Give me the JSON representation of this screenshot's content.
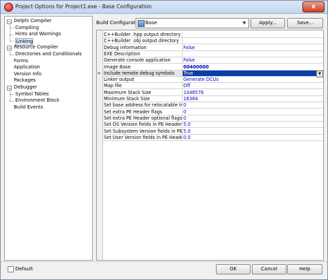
{
  "window": {
    "title": "Project Options for Project1.exe - Base Configuration",
    "close_glyph": "x"
  },
  "tree": {
    "items": [
      {
        "label": "Delphi Compiler",
        "level": 0,
        "expander": "−"
      },
      {
        "label": "Compiling",
        "level": 1
      },
      {
        "label": "Hints and Warnings",
        "level": 1
      },
      {
        "label": "Linking",
        "level": 1,
        "selected": true
      },
      {
        "label": "Resource Compiler",
        "level": 0,
        "expander": "−"
      },
      {
        "label": "Directories and Conditionals",
        "level": 1
      },
      {
        "label": "Forms",
        "level": 0
      },
      {
        "label": "Application",
        "level": 0
      },
      {
        "label": "Version Info",
        "level": 0
      },
      {
        "label": "Packages",
        "level": 0
      },
      {
        "label": "Debugger",
        "level": 0,
        "expander": "−"
      },
      {
        "label": "Symbol Tables",
        "level": 1
      },
      {
        "label": "Environment Block",
        "level": 1
      },
      {
        "label": "Build Events",
        "level": 0
      }
    ]
  },
  "build_config": {
    "label": "Build Configuration",
    "value": "Base",
    "apply_label": "Apply...",
    "save_label": "Save..."
  },
  "options": [
    {
      "name": "C++Builder .hpp output directory",
      "value": ""
    },
    {
      "name": "C++Builder .obj output directory",
      "value": ""
    },
    {
      "name": "Debug information",
      "value": "False"
    },
    {
      "name": "EXE Description",
      "value": ""
    },
    {
      "name": "Generate console application",
      "value": "False"
    },
    {
      "name": "Image Base",
      "value": "00400000",
      "bold": true
    },
    {
      "name": "Include remote debug symbols",
      "value": "True",
      "active": true
    },
    {
      "name": "Linker output",
      "value": "Generate DCUs"
    },
    {
      "name": "Map file",
      "value": "Off"
    },
    {
      "name": "Maximum Stack Size",
      "value": "1048576"
    },
    {
      "name": "Minimum Stack Size",
      "value": "16384"
    },
    {
      "name": "Set base address for relocatable images",
      "value": "0"
    },
    {
      "name": "Set extra PE Header flags",
      "value": "0"
    },
    {
      "name": "Set extra PE Header optional flags",
      "value": "0"
    },
    {
      "name": "Set OS Version fields in PE Header as <m",
      "value": "5.0"
    },
    {
      "name": "Set Subsystem Version fields in PE Head",
      "value": "5.0"
    },
    {
      "name": "Set User Version fields in PE Header as",
      "value": "0.0"
    }
  ],
  "row_marker": "»",
  "footer": {
    "default_label": "Default",
    "ok_label": "OK",
    "cancel_label": "Cancel",
    "help_label": "Help"
  }
}
